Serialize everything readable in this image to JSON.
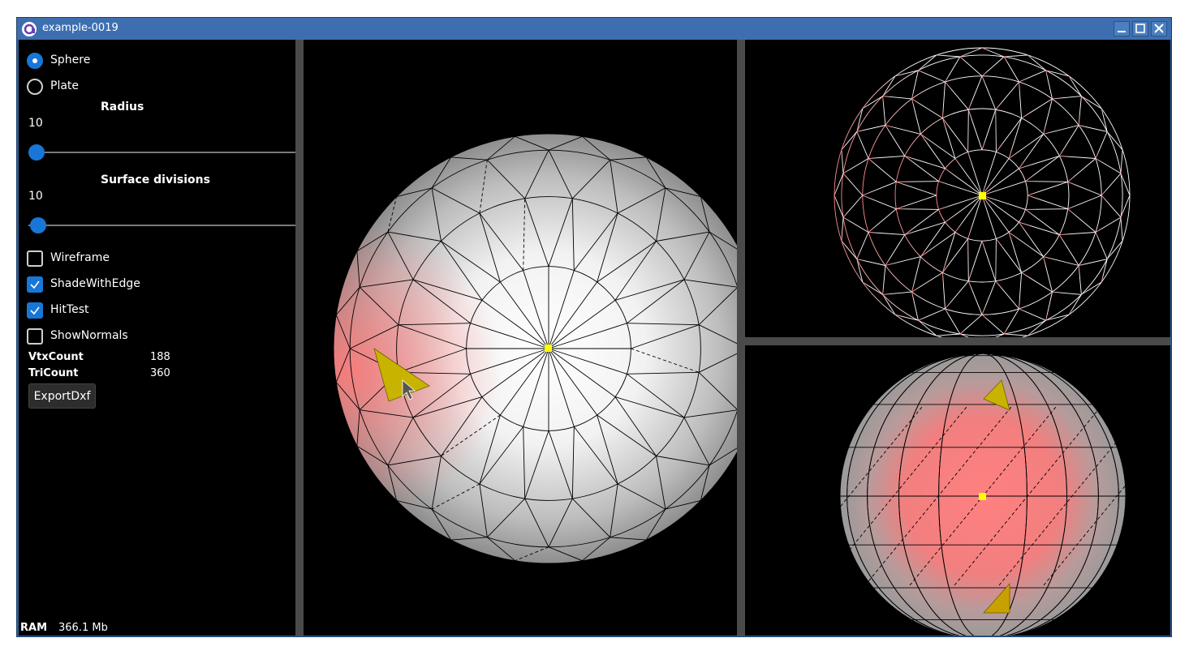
{
  "window": {
    "title": "example-0019",
    "app_icon": "app-logo-icon",
    "controls": [
      "minimize-icon",
      "maximize-icon",
      "close-icon"
    ]
  },
  "panel": {
    "shape_options": [
      {
        "label": "Sphere",
        "selected": true
      },
      {
        "label": "Plate",
        "selected": false
      }
    ],
    "radius": {
      "label": "Radius",
      "value": "10"
    },
    "surface_divisions": {
      "label": "Surface divisions",
      "value": "10"
    },
    "checkboxes": [
      {
        "label": "Wireframe",
        "checked": false
      },
      {
        "label": "ShadeWithEdge",
        "checked": true
      },
      {
        "label": "HitTest",
        "checked": true
      },
      {
        "label": "ShowNormals",
        "checked": false
      }
    ],
    "stats": [
      {
        "label": "VtxCount",
        "value": "188"
      },
      {
        "label": "TriCount",
        "value": "360"
      }
    ],
    "export_button": "ExportDxf"
  },
  "status": {
    "ram_label": "RAM",
    "ram_value": "366.1 Mb"
  },
  "colors": {
    "accent": "#1877d6",
    "titlebar": "#3d6fb0",
    "viewport_bg": "#000000",
    "separator": "#4a4a4a",
    "highlight_triangle": "#c8b400",
    "hit_point": "#ffff00",
    "tint": "#ff7a7a"
  },
  "views": [
    "main-viewport",
    "top-right-viewport",
    "bottom-right-viewport"
  ]
}
